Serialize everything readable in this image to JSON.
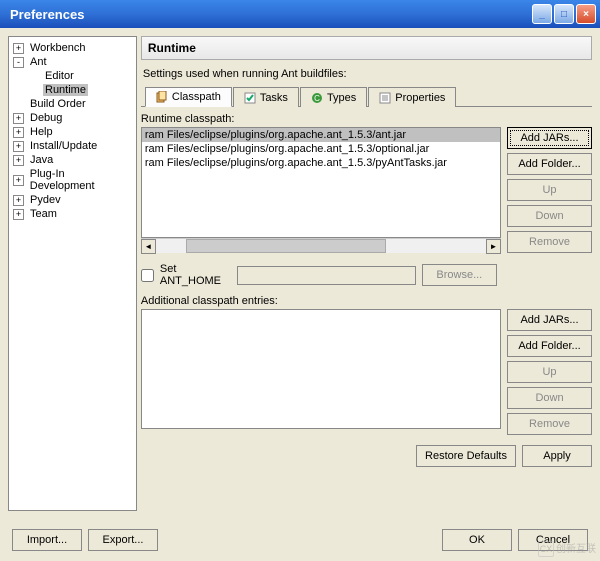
{
  "window": {
    "title": "Preferences"
  },
  "tree": {
    "items": [
      {
        "label": "Workbench",
        "exp": "+",
        "level": 1
      },
      {
        "label": "Ant",
        "exp": "-",
        "level": 1
      },
      {
        "label": "Editor",
        "exp": "",
        "level": 2
      },
      {
        "label": "Runtime",
        "exp": "",
        "level": 2,
        "selected": true
      },
      {
        "label": "Build Order",
        "exp": "",
        "level": 1
      },
      {
        "label": "Debug",
        "exp": "+",
        "level": 1
      },
      {
        "label": "Help",
        "exp": "+",
        "level": 1
      },
      {
        "label": "Install/Update",
        "exp": "+",
        "level": 1
      },
      {
        "label": "Java",
        "exp": "+",
        "level": 1
      },
      {
        "label": "Plug-In Development",
        "exp": "+",
        "level": 1
      },
      {
        "label": "Pydev",
        "exp": "+",
        "level": 1
      },
      {
        "label": "Team",
        "exp": "+",
        "level": 1
      }
    ]
  },
  "page": {
    "title": "Runtime",
    "desc": "Settings used when running Ant buildfiles:",
    "tabs": [
      {
        "label": "Classpath",
        "active": true
      },
      {
        "label": "Tasks",
        "active": false
      },
      {
        "label": "Types",
        "active": false
      },
      {
        "label": "Properties",
        "active": false
      }
    ],
    "runtime_label": "Runtime classpath:",
    "runtime_list": [
      "ram Files/eclipse/plugins/org.apache.ant_1.5.3/ant.jar",
      "ram Files/eclipse/plugins/org.apache.ant_1.5.3/optional.jar",
      "ram Files/eclipse/plugins/org.apache.ant_1.5.3/pyAntTasks.jar"
    ],
    "btns": {
      "add_jars": "Add JARs...",
      "add_folder": "Add Folder...",
      "up": "Up",
      "down": "Down",
      "remove": "Remove",
      "browse": "Browse...",
      "restore": "Restore Defaults",
      "apply": "Apply"
    },
    "set_home": "Set ANT_HOME",
    "additional_label": "Additional classpath entries:"
  },
  "footer": {
    "import": "Import...",
    "export": "Export...",
    "ok": "OK",
    "cancel": "Cancel"
  },
  "watermark": {
    "text": "创新互联"
  }
}
